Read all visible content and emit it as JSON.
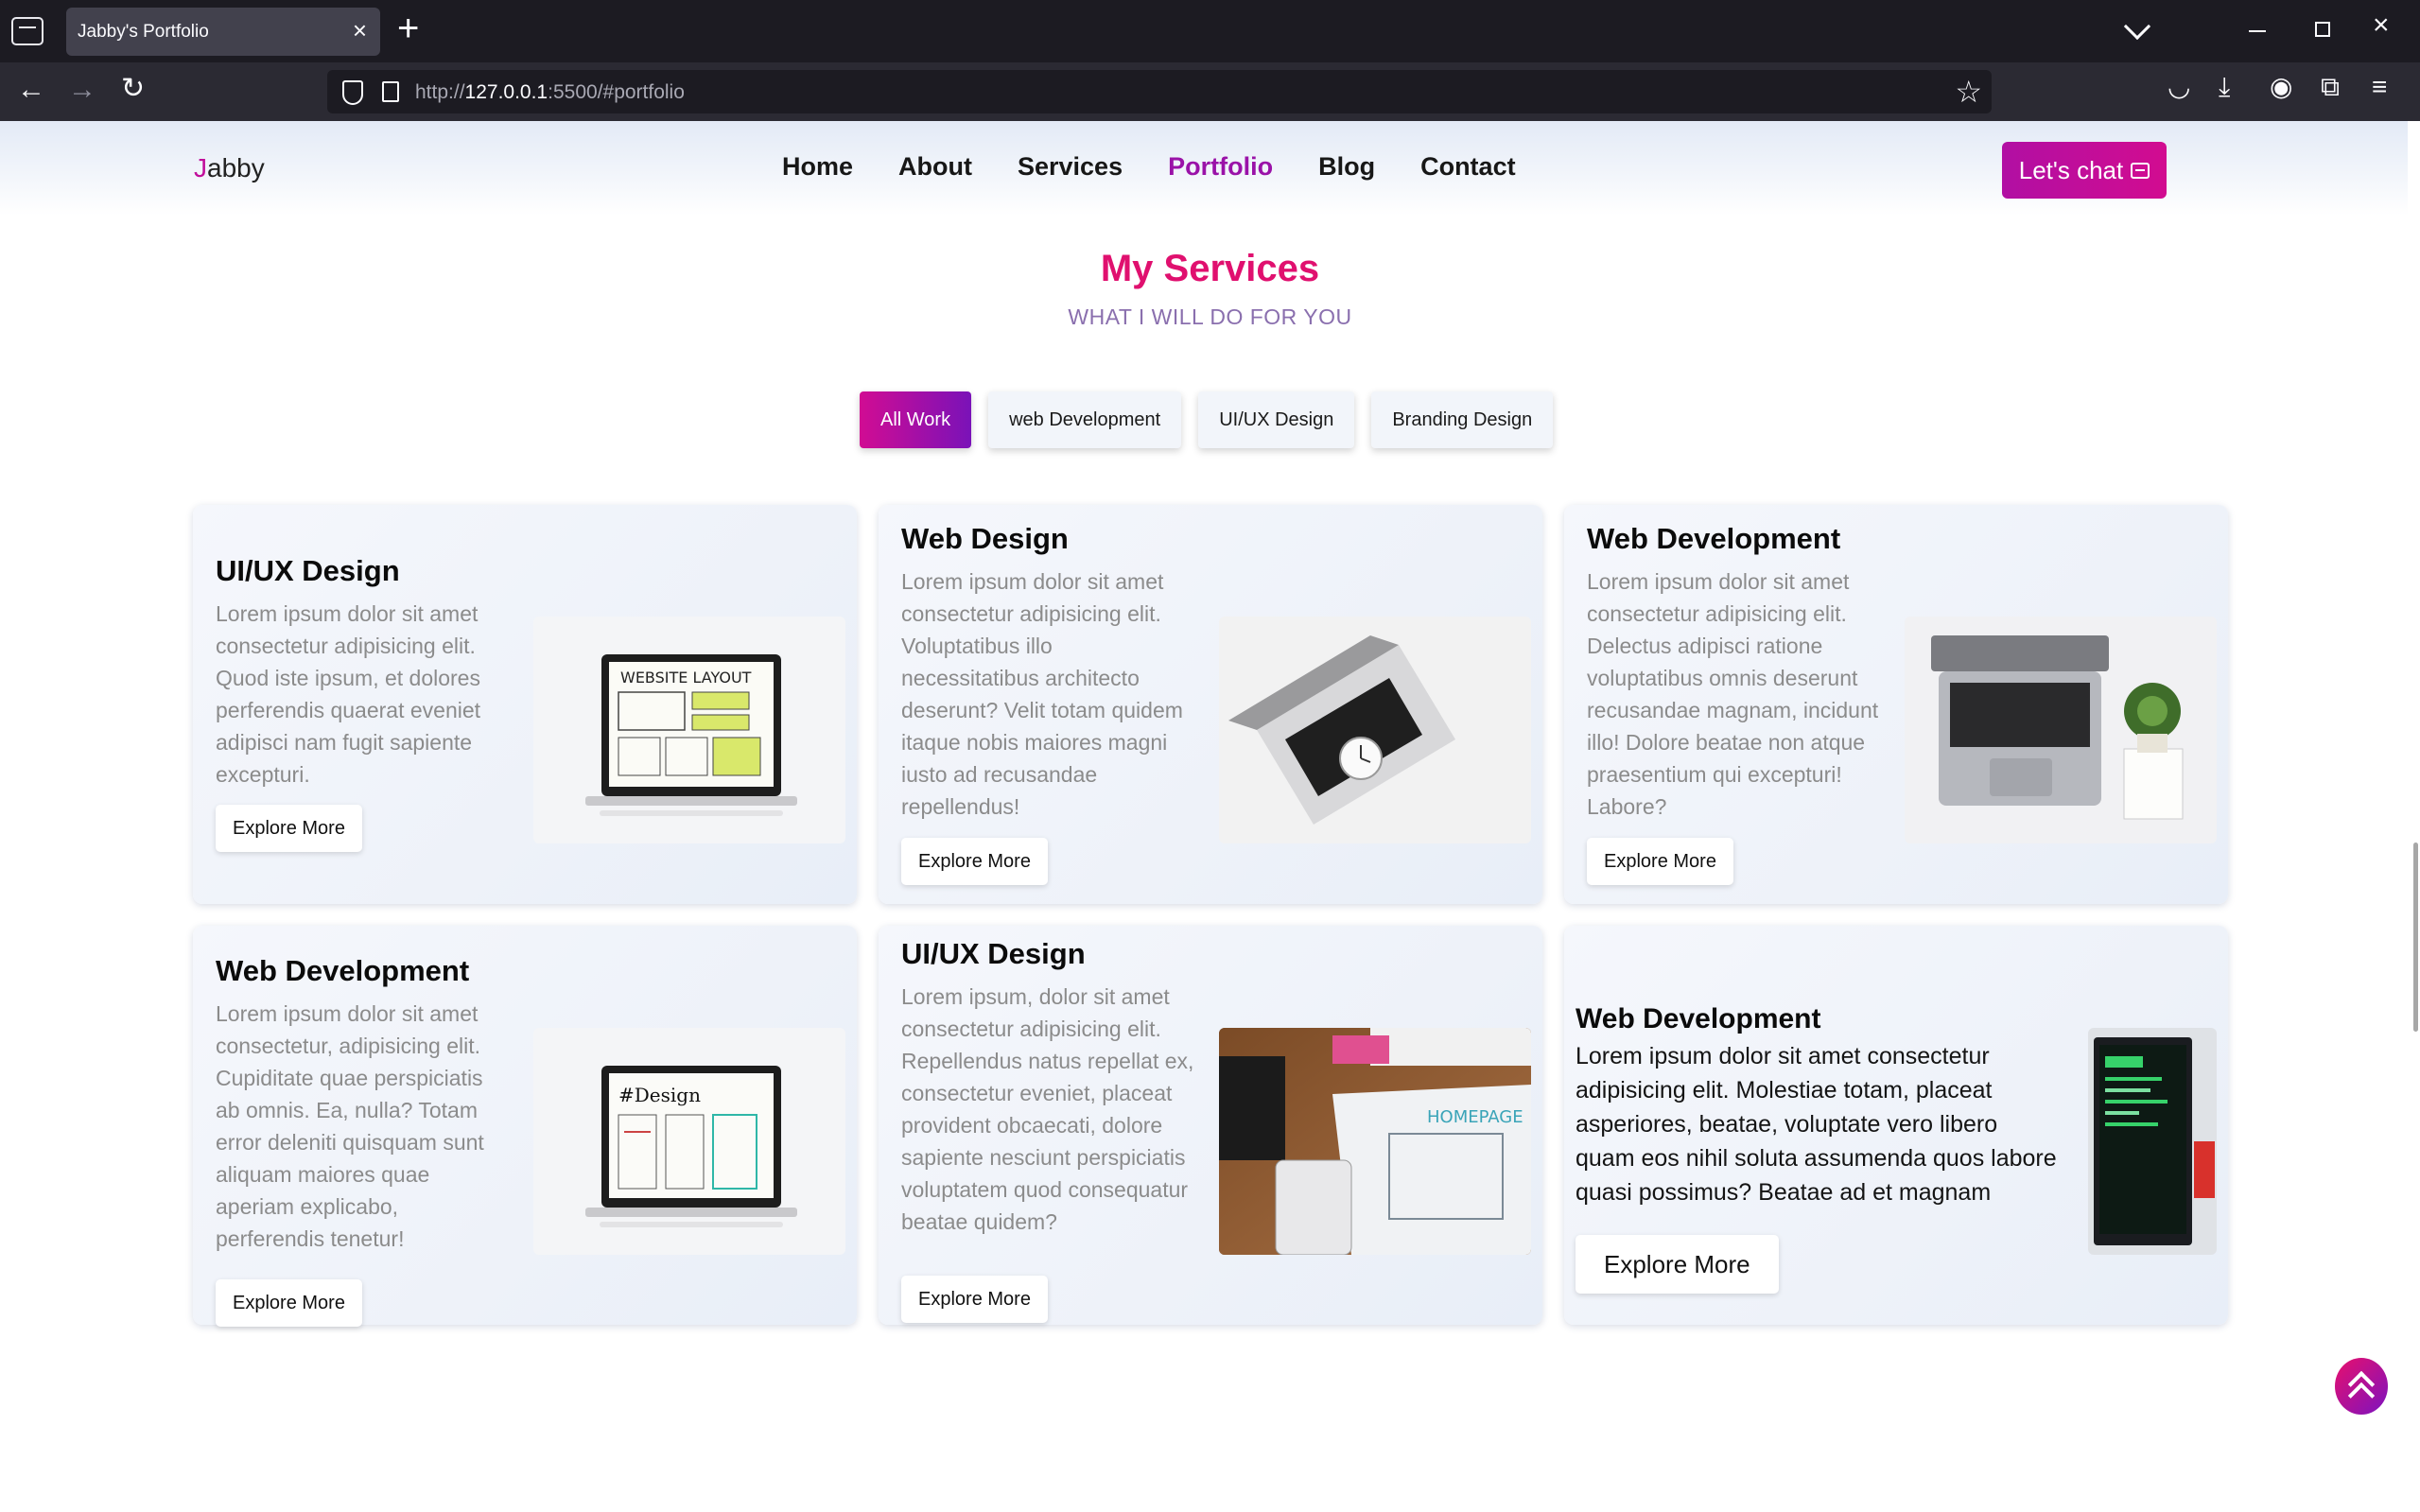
{
  "browser": {
    "tab_title": "Jabby's Portfolio",
    "url_prefix": "http://",
    "url_host": "127.0.0.1",
    "url_rest": ":5500/#portfolio"
  },
  "header": {
    "logo_first": "J",
    "logo_rest": "abby",
    "menu": [
      "Home",
      "About",
      "Services",
      "Portfolio",
      "Blog",
      "Contact"
    ],
    "active_menu": "Portfolio",
    "cta_label": "Let's chat"
  },
  "section": {
    "title": "My Services",
    "subtitle": "WHAT I WILL DO FOR YOU"
  },
  "filters": [
    "All Work",
    "web Development",
    "UI/UX Design",
    "Branding Design"
  ],
  "active_filter": "All Work",
  "cards": [
    {
      "title": "UI/UX Design",
      "text": "Lorem ipsum dolor sit amet consectetur adipisicing elit. Quod iste ipsum, et dolores perferendis quaerat eveniet adipisci nam fugit sapiente excepturi.",
      "button": "Explore More",
      "image": "laptop-website-layout"
    },
    {
      "title": "Web Design",
      "text": "Lorem ipsum dolor sit amet consectetur adipisicing elit. Voluptatibus illo necessitatibus architecto deserunt? Velit totam quidem itaque nobis maiores magni iusto ad recusandae repellendus!",
      "button": "Explore More",
      "image": "laptop-top-view-clock"
    },
    {
      "title": "Web Development",
      "text": "Lorem ipsum dolor sit amet consectetur adipisicing elit. Delectus adipisci ratione voluptatibus omnis deserunt recusandae magnam, incidunt illo! Dolore beatae non atque praesentium qui excepturi! Labore?",
      "button": "Explore More",
      "image": "laptop-with-plant"
    },
    {
      "title": "Web Development",
      "text": "Lorem ipsum dolor sit amet consectetur, adipisicing elit. Cupiditate quae perspiciatis ab omnis. Ea, nulla? Totam error deleniti quisquam sunt aliquam maiores quae aperiam explicabo, perferendis tenetur!",
      "button": "Explore More",
      "image": "laptop-design-sketch"
    },
    {
      "title": "UI/UX Design",
      "text": "Lorem ipsum, dolor sit amet consectetur adipisicing elit. Repellendus natus repellat ex, consectetur eveniet, placeat provident obcaecati, dolore sapiente nesciunt perspiciatis voluptatem quod consequatur beatae quidem?",
      "button": "Explore More",
      "image": "homepage-sketch-desk"
    },
    {
      "title": "Web Development",
      "text": "Lorem ipsum dolor sit amet consectetur adipisicing elit. Molestiae totam, placeat asperiores, beatae, voluptate vero libero quam eos nihil soluta assumenda quos labore quasi possimus? Beatae ad et magnam porro!",
      "button": "Explore More",
      "image": "laptop-code-screen"
    }
  ],
  "colors": {
    "accent_pink": "#e0106f",
    "accent_purple": "#9a12a8",
    "chrome_dark": "#1c1b22"
  },
  "icons": [
    "tab-list-icon",
    "close-icon",
    "plus-icon",
    "chevron-down-icon",
    "back-icon",
    "forward-icon",
    "reload-icon",
    "shield-icon",
    "page-icon",
    "star-icon",
    "pocket-icon",
    "download-icon",
    "account-icon",
    "extensions-icon",
    "menu-icon",
    "chat-icon",
    "scroll-top-icon"
  ]
}
